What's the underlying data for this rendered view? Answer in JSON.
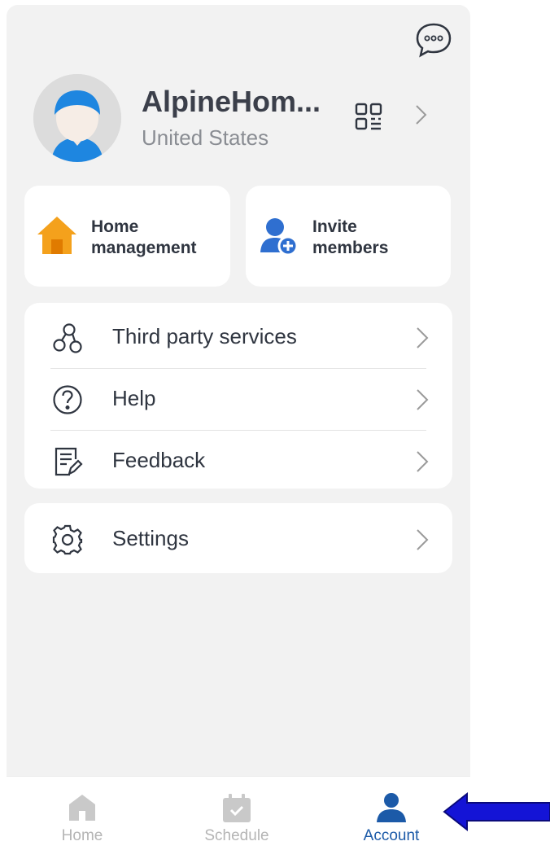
{
  "header": {
    "message_icon": "chat-bubble-icon"
  },
  "profile": {
    "name": "AlpineHom...",
    "country": "United States",
    "qr_icon": "qr-code-icon"
  },
  "quick_actions": [
    {
      "label_line1": "Home",
      "label_line2": "management",
      "icon": "house-icon",
      "color": "#f4a11c"
    },
    {
      "label_line1": "Invite",
      "label_line2": "members",
      "icon": "add-user-icon",
      "color": "#2f6fd0"
    }
  ],
  "menu": [
    {
      "label": "Third party services",
      "icon": "link-nodes-icon"
    },
    {
      "label": "Help",
      "icon": "help-circle-icon"
    },
    {
      "label": "Feedback",
      "icon": "feedback-icon"
    }
  ],
  "settings": {
    "label": "Settings",
    "icon": "gear-icon"
  },
  "tabbar": {
    "tabs": [
      {
        "label": "Home",
        "icon": "home-icon",
        "active": false
      },
      {
        "label": "Schedule",
        "icon": "calendar-icon",
        "active": false
      },
      {
        "label": "Account",
        "icon": "person-icon",
        "active": true
      }
    ]
  },
  "colors": {
    "accent": "#1c5aa8",
    "arrow": "#1414d6",
    "background": "#f2f2f2"
  }
}
